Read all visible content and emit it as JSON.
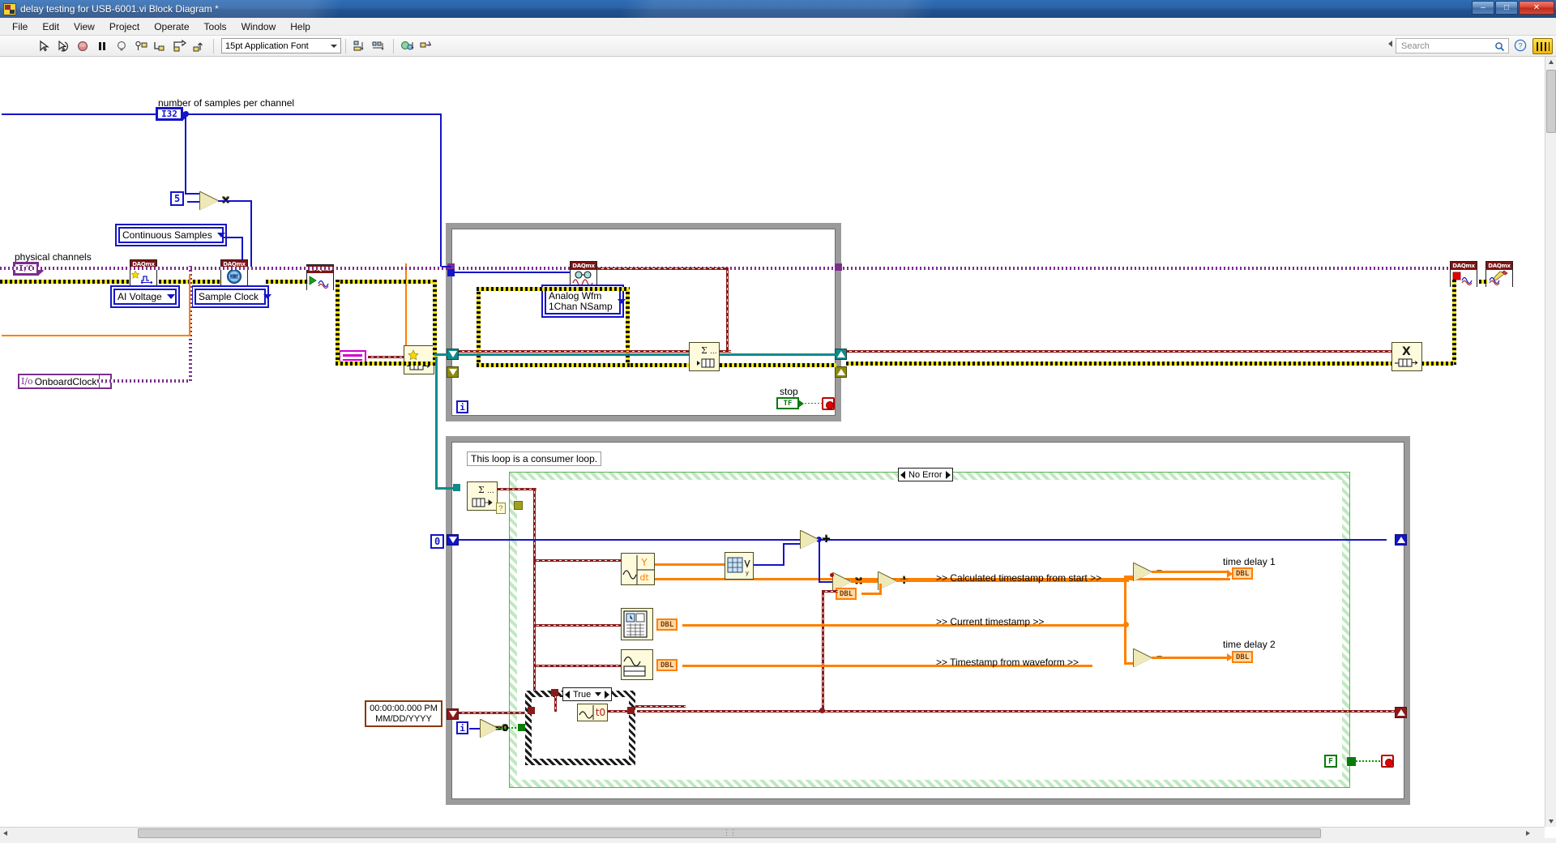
{
  "window": {
    "title": "delay testing for USB-6001.vi Block Diagram *",
    "icon": "labview-vi-icon",
    "buttons": {
      "minimize": "–",
      "maximize": "□",
      "close": "✕"
    }
  },
  "menubar": {
    "items": [
      "File",
      "Edit",
      "View",
      "Project",
      "Operate",
      "Tools",
      "Window",
      "Help"
    ]
  },
  "toolbar": {
    "run": "run-arrow-icon",
    "run_continuously": "run-continuously-icon",
    "abort": "abort-execution-icon",
    "pause": "pause-icon",
    "highlight_execution": "highlight-execution-lightbulb-icon",
    "retain_wire_values": "retain-wire-values-icon",
    "step_into": "step-into-icon",
    "step_over": "step-over-icon",
    "step_out": "step-out-icon",
    "font_selector": "15pt Application Font",
    "align_objects": "align-objects-icon",
    "distribute_objects": "distribute-objects-icon",
    "resize_objects": "resize-objects-icon",
    "reorder": "reorder-icon",
    "clean_up_diagram": "clean-up-diagram-icon",
    "search_placeholder": "Search",
    "search_icon": "magnifier-icon",
    "help_icon": "question-mark-help-icon",
    "ni_logo": "ni-labview-logo"
  },
  "diagram": {
    "labels": {
      "number_of_samples": "number of samples per channel",
      "physical_channels": "physical channels",
      "stop": "stop",
      "consumer_comment": "This loop is a consumer loop.",
      "calculated_timestamp": ">> Calculated timestamp from start >>",
      "current_timestamp": ">> Current timestamp >>",
      "timestamp_from_waveform": ">> Timestamp from waveform >>",
      "time_delay_1": "time delay 1",
      "time_delay_2": "time delay 2"
    },
    "terminals": {
      "num_samples_type": "I32",
      "physical_channels_type": "I/O",
      "dbl": "DBL",
      "iteration": "i",
      "bool_false": "F",
      "stop_tf": "TF"
    },
    "constants": {
      "multiplier": "5",
      "onboard_clock": "OnboardClock",
      "timestamp_default_time": "00:00:00.000 PM",
      "timestamp_default_date": "MM/DD/YYYY",
      "zero_compare": "=0",
      "array_index_zero": "0"
    },
    "rings": {
      "sample_mode": "Continuous Samples",
      "ai_measurement_type": "AI Voltage",
      "timing_type": "Sample Clock",
      "read_instance_line1": "Analog Wfm",
      "read_instance_line2": "1Chan NSamp",
      "case_selector_true": "True",
      "error_case": "No Error"
    },
    "nodes": {
      "daqmx_create_channel": "DAQmx Create Virtual Channel",
      "daqmx_timing": "DAQmx Timing",
      "daqmx_start_task": "DAQmx Start Task",
      "daqmx_read": "DAQmx Read",
      "daqmx_stop_task": "DAQmx Stop Task",
      "daqmx_clear_task": "DAQmx Clear Task",
      "obtain_queue": "Obtain Queue",
      "enqueue_element": "Enqueue Element",
      "dequeue_element": "Dequeue Element",
      "release_queue": "Release Queue",
      "multiply": "×",
      "add": "+",
      "subtract": "–",
      "get_waveform_components_y": "Y",
      "get_waveform_components_dt": "dt",
      "get_waveform_components_t0": "t0",
      "array_size": "array-size-icon",
      "get_date_time_seconds": "get-date-time-in-seconds-icon",
      "to_double": "DBL"
    },
    "queue_name_constant": "queue-name-string-constant"
  },
  "scroll": {
    "horizontal_grip": "⋮⋮"
  }
}
